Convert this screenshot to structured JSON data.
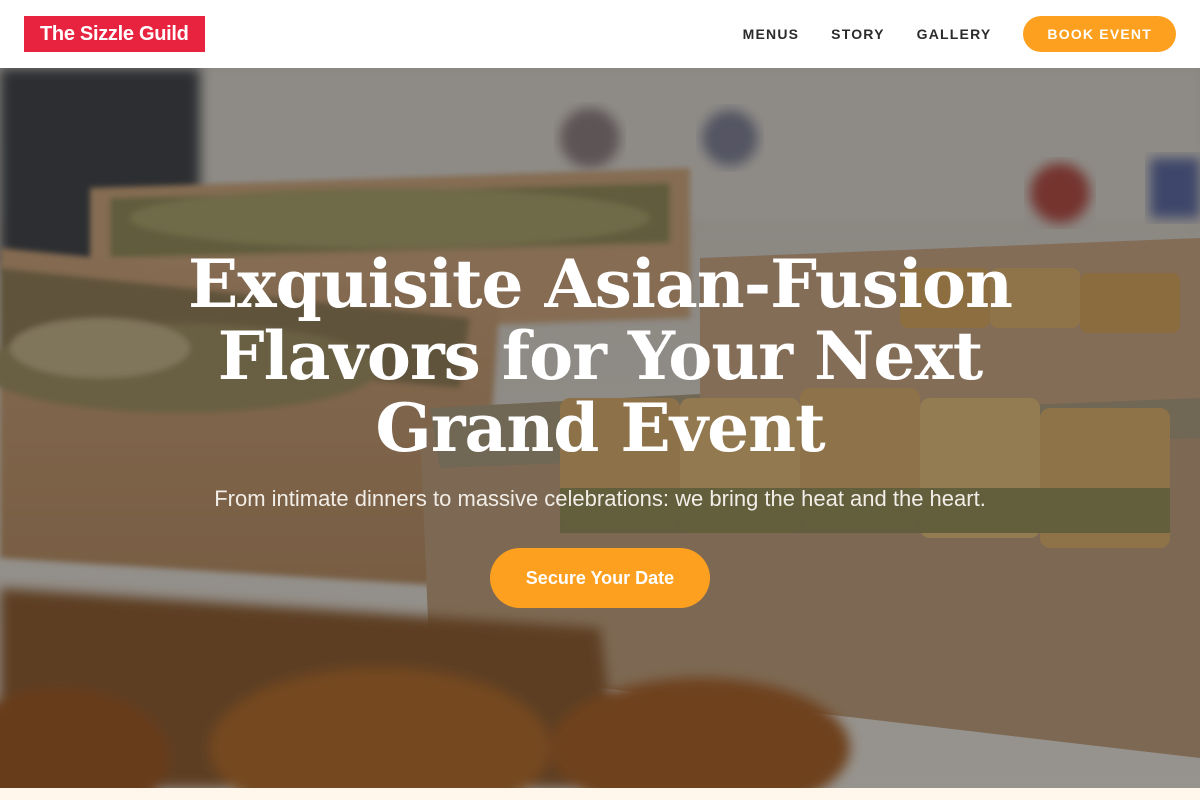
{
  "header": {
    "logo": "The Sizzle Guild",
    "nav": [
      {
        "label": "MENUS"
      },
      {
        "label": "STORY"
      },
      {
        "label": "GALLERY"
      }
    ],
    "book_label": "BOOK EVENT"
  },
  "hero": {
    "title": "Exquisite Asian-Fusion Flavors for Your Next Grand Event",
    "subtitle": "From intimate dinners to massive celebrations: we bring the heat and the heart.",
    "cta_label": "Secure Your Date",
    "background": "catering boxes with sandwiches and pastries"
  },
  "colors": {
    "brand_red": "#e8233f",
    "accent_orange": "#fda01f"
  }
}
